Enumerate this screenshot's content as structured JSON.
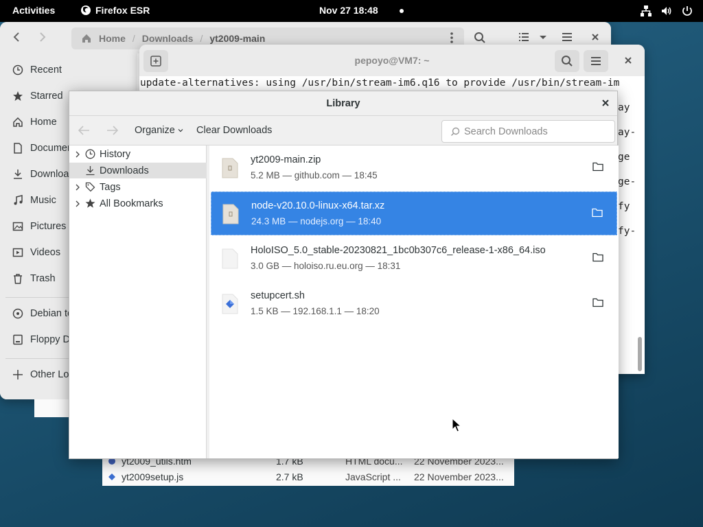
{
  "topbar": {
    "activities": "Activities",
    "app_name": "Firefox ESR",
    "clock": "Nov 27  18:48"
  },
  "files_window": {
    "path": {
      "home": "Home",
      "downloads": "Downloads",
      "current": "yt2009-main"
    },
    "sidebar": {
      "recent": "Recent",
      "starred": "Starred",
      "home": "Home",
      "documents": "Documen",
      "downloads": "Downloa",
      "music": "Music",
      "pictures": "Pictures",
      "videos": "Videos",
      "trash": "Trash",
      "debian": "Debian te",
      "floppy": "Floppy D",
      "other": "Other Lo"
    },
    "rows": [
      {
        "name": "yt2009_utils.htm",
        "size": "1.7 kB",
        "type": "HTML docu...",
        "date": "22 November 2023..."
      },
      {
        "name": "yt2009setup.js",
        "size": "2.7 kB",
        "type": "JavaScript ...",
        "date": "22 November 2023..."
      }
    ]
  },
  "terminal": {
    "title": "pepoyo@VM7: ~",
    "line1": "update-alternatives: using /usr/bin/stream-im6.q16 to provide /usr/bin/stream-im",
    "frag1": "ay",
    "frag2": "ay-",
    "frag3": "ge",
    "frag4": "ge-",
    "frag5": "fy",
    "frag6": "fy-"
  },
  "library": {
    "title": "Library",
    "organize": "Organize",
    "clear_downloads": "Clear Downloads",
    "search_placeholder": "Search Downloads",
    "tree": {
      "history": "History",
      "downloads": "Downloads",
      "tags": "Tags",
      "bookmarks": "All Bookmarks"
    },
    "downloads": [
      {
        "name": "yt2009-main.zip",
        "meta": "5.2 MB — github.com — 18:45"
      },
      {
        "name": "node-v20.10.0-linux-x64.tar.xz",
        "meta": "24.3 MB — nodejs.org — 18:40"
      },
      {
        "name": "HoloISO_5.0_stable-20230821_1bc0b307c6_release-1-x86_64.iso",
        "meta": "3.0 GB — holoiso.ru.eu.org — 18:31"
      },
      {
        "name": "setupcert.sh",
        "meta": "1.5 KB — 192.168.1.1 — 18:20"
      }
    ]
  },
  "colors": {
    "selection": "#3584e4",
    "topbar": "#000000",
    "desktop": "#1f5877"
  }
}
